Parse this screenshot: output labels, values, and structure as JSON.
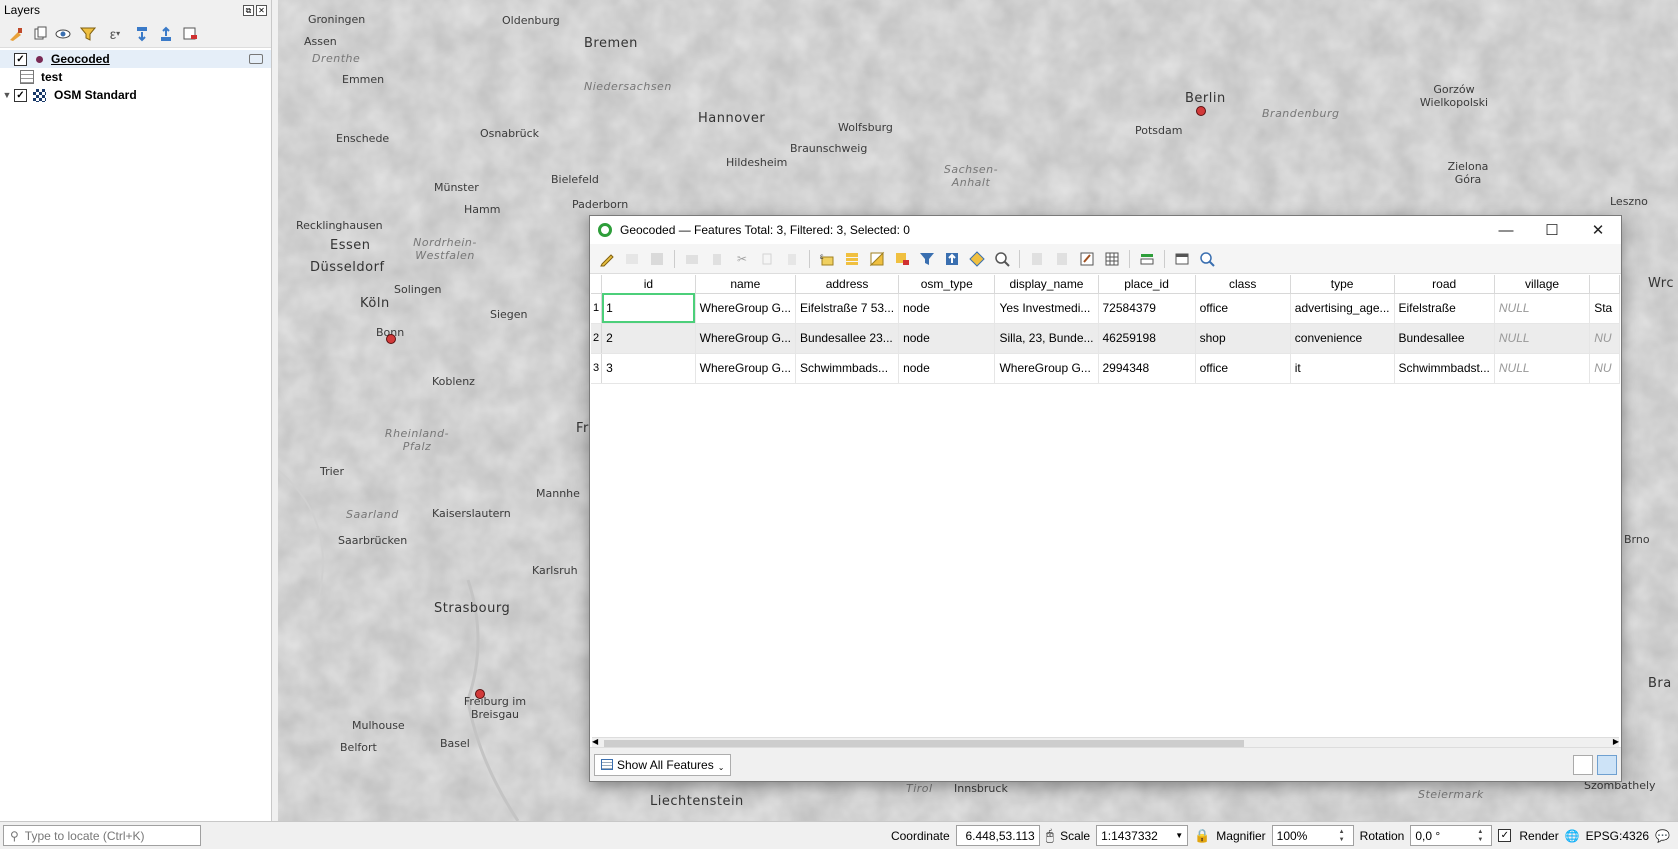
{
  "layers_panel": {
    "title": "Layers",
    "layers": [
      {
        "name": "Geocoded",
        "checked": true,
        "icon": "point-layer-icon",
        "selected": true
      },
      {
        "name": "test",
        "checked": null,
        "icon": "table-icon",
        "selected": false
      },
      {
        "name": "OSM Standard",
        "checked": true,
        "icon": "raster-tile-icon",
        "selected": false
      }
    ]
  },
  "map": {
    "labels": [
      {
        "text": "Groningen",
        "cls": "mid"
      },
      {
        "text": "Oldenburg",
        "cls": "mid"
      },
      {
        "text": "Bremen",
        "cls": "big"
      },
      {
        "text": "Assen",
        "cls": "mid"
      },
      {
        "text": "Drenthe",
        "cls": "reg"
      },
      {
        "text": "Emmen",
        "cls": "mid"
      },
      {
        "text": "Niedersachsen",
        "cls": "reg"
      },
      {
        "text": "Hannover",
        "cls": "big"
      },
      {
        "text": "Wolfsburg",
        "cls": "mid"
      },
      {
        "text": "Braunschweig",
        "cls": "mid"
      },
      {
        "text": "Hildesheim",
        "cls": "mid"
      },
      {
        "text": "Berlin",
        "cls": "big"
      },
      {
        "text": "Potsdam",
        "cls": "mid"
      },
      {
        "text": "Brandenburg",
        "cls": "reg"
      },
      {
        "text": "Gorzów Wielkopolski",
        "cls": "mid"
      },
      {
        "text": "Enschede",
        "cls": "mid"
      },
      {
        "text": "Osnabrück",
        "cls": "mid"
      },
      {
        "text": "Bielefeld",
        "cls": "mid"
      },
      {
        "text": "Sachsen-Anhalt",
        "cls": "reg"
      },
      {
        "text": "Zielona Góra",
        "cls": "mid"
      },
      {
        "text": "Münster",
        "cls": "mid"
      },
      {
        "text": "Hamm",
        "cls": "mid"
      },
      {
        "text": "Paderborn",
        "cls": "mid"
      },
      {
        "text": "Recklinghausen",
        "cls": "mid"
      },
      {
        "text": "Essen",
        "cls": "big"
      },
      {
        "text": "Nordrhein-Westfalen",
        "cls": "reg"
      },
      {
        "text": "Düsseldorf",
        "cls": "big"
      },
      {
        "text": "Solingen",
        "cls": "mid"
      },
      {
        "text": "Köln",
        "cls": "big"
      },
      {
        "text": "Siegen",
        "cls": "mid"
      },
      {
        "text": "Bonn",
        "cls": "mid"
      },
      {
        "text": "Koblenz",
        "cls": "mid"
      },
      {
        "text": "Rheinland-Pfalz",
        "cls": "reg"
      },
      {
        "text": "Trier",
        "cls": "mid"
      },
      {
        "text": "Saarland",
        "cls": "reg"
      },
      {
        "text": "Kaiserslautern",
        "cls": "mid"
      },
      {
        "text": "Saarbrücken",
        "cls": "mid"
      },
      {
        "text": "Strasbourg",
        "cls": "big"
      },
      {
        "text": "Freiburg im Breisgau",
        "cls": "mid"
      },
      {
        "text": "Mulhouse",
        "cls": "mid"
      },
      {
        "text": "Belfort",
        "cls": "mid"
      },
      {
        "text": "Basel",
        "cls": "mid"
      },
      {
        "text": "Liechtenstein",
        "cls": "big"
      },
      {
        "text": "Tirol",
        "cls": "reg"
      },
      {
        "text": "Innsbruck",
        "cls": "mid"
      },
      {
        "text": "Steiermark",
        "cls": "reg"
      },
      {
        "text": "Szombathely",
        "cls": "mid"
      },
      {
        "text": "Leszno",
        "cls": "mid"
      },
      {
        "text": "Frank",
        "cls": "big"
      },
      {
        "text": "Mannhe",
        "cls": "mid"
      },
      {
        "text": "Karlsruh",
        "cls": "mid"
      },
      {
        "text": "Brno",
        "cls": "mid"
      },
      {
        "text": "Bra",
        "cls": "big"
      },
      {
        "text": "Wrc",
        "cls": "big"
      }
    ]
  },
  "attribute_table": {
    "title": "Geocoded — Features Total: 3, Filtered: 3, Selected: 0",
    "columns": [
      "id",
      "name",
      "address",
      "osm_type",
      "display_name",
      "place_id",
      "class",
      "type",
      "road",
      "village",
      ""
    ],
    "rows": [
      {
        "num": "1",
        "cells": [
          "1",
          "WhereGroup G...",
          "Eifelstraße 7 53...",
          "node",
          "Yes Investmedi...",
          "72584379",
          "office",
          "advertising_age...",
          "Eifelstraße",
          "NULL",
          "Sta"
        ]
      },
      {
        "num": "2",
        "cells": [
          "2",
          "WhereGroup G...",
          "Bundesallee 23...",
          "node",
          "Silla, 23, Bunde...",
          "46259198",
          "shop",
          "convenience",
          "Bundesallee",
          "NULL",
          "NU"
        ]
      },
      {
        "num": "3",
        "cells": [
          "3",
          "WhereGroup G...",
          "Schwimmbads...",
          "node",
          "WhereGroup G...",
          "2994348",
          "office",
          "it",
          "Schwimmbadst...",
          "NULL",
          "NU"
        ]
      }
    ],
    "show_all_label": "Show All Features"
  },
  "statusbar": {
    "locator_placeholder": "Type to locate (Ctrl+K)",
    "coordinate_label": "Coordinate",
    "coordinate_value": "6.448,53.113",
    "scale_label": "Scale",
    "scale_value": "1:1437332",
    "magnifier_label": "Magnifier",
    "magnifier_value": "100%",
    "rotation_label": "Rotation",
    "rotation_value": "0,0 °",
    "render_label": "Render",
    "crs_label": "EPSG:4326"
  }
}
